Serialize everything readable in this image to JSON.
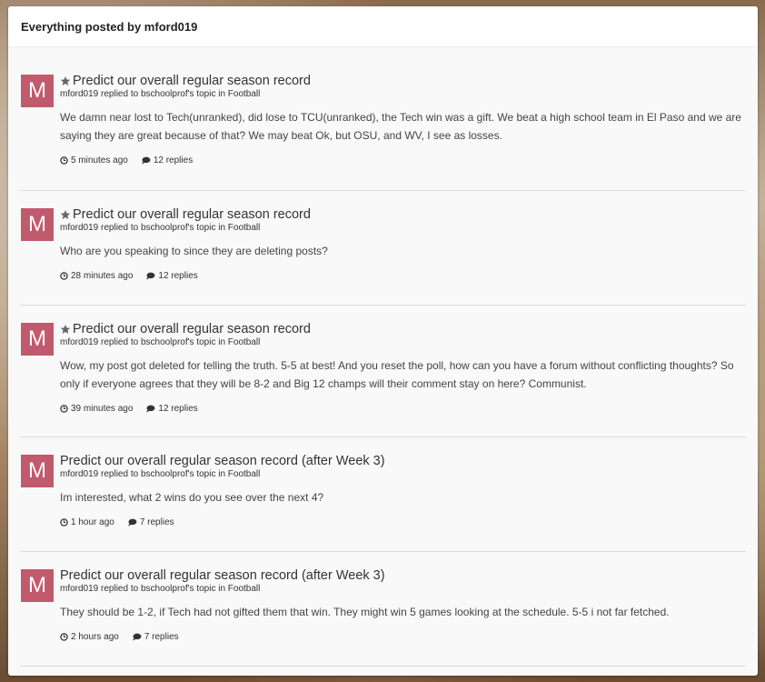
{
  "header": {
    "title": "Everything posted by mford019"
  },
  "posts": [
    {
      "avatar_letter": "M",
      "pinned": true,
      "title": "Predict our overall regular season record",
      "meta": "mford019 replied to bschoolprof's topic in Football",
      "content": "We damn near lost to Tech(unranked), did lose to TCU(unranked), the Tech win was a gift. We beat a high school team in El Paso and we are saying they are great because of that? We may beat Ok, but OSU, and WV, I see as losses.",
      "time": "5 minutes ago",
      "replies": "12 replies"
    },
    {
      "avatar_letter": "M",
      "pinned": true,
      "title": "Predict our overall regular season record",
      "meta": "mford019 replied to bschoolprof's topic in Football",
      "content": "Who are you speaking to since they are deleting posts?",
      "time": "28 minutes ago",
      "replies": "12 replies"
    },
    {
      "avatar_letter": "M",
      "pinned": true,
      "title": "Predict our overall regular season record",
      "meta": "mford019 replied to bschoolprof's topic in Football",
      "content": "Wow, my post got deleted for telling the truth. 5-5 at best! And you reset the poll, how can you have a forum without conflicting thoughts? So only if everyone agrees that they will be 8-2 and Big 12 champs will their comment stay on here? Communist.",
      "time": "39 minutes ago",
      "replies": "12 replies"
    },
    {
      "avatar_letter": "M",
      "pinned": false,
      "title": "Predict our overall regular season record (after Week 3)",
      "meta": "mford019 replied to bschoolprof's topic in Football",
      "content": "Im interested, what 2 wins do you see over the next 4?",
      "time": "1 hour ago",
      "replies": "7 replies"
    },
    {
      "avatar_letter": "M",
      "pinned": false,
      "title": "Predict our overall regular season record (after Week 3)",
      "meta": "mford019 replied to bschoolprof's topic in Football",
      "content": "They should be 1-2, if Tech had not gifted them that win. They might win 5 games looking at the schedule. 5-5 i not far fetched.",
      "time": "2 hours ago",
      "replies": "7 replies"
    }
  ],
  "icons": {
    "pinned": "star-icon",
    "time": "clock-icon",
    "replies": "comment-icon"
  },
  "colors": {
    "avatar": "#c15a6c",
    "panel": "#f9f9f9"
  }
}
